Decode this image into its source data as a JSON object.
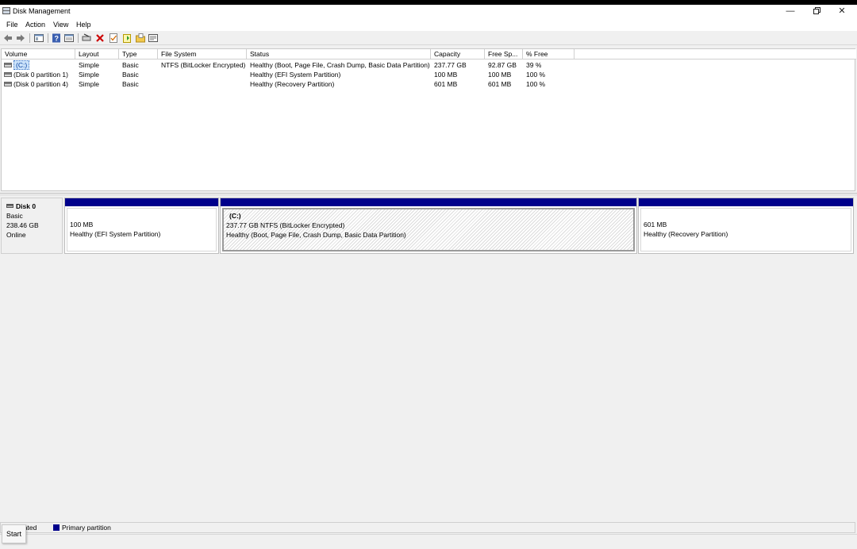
{
  "window": {
    "title": "Disk Management",
    "minimize_glyph": "—",
    "close_glyph": "✕"
  },
  "menu": {
    "file": "File",
    "action": "Action",
    "view": "View",
    "help": "Help"
  },
  "toolbar": {
    "icons": [
      "back-arrow-icon",
      "forward-arrow-icon",
      "console-tree-icon",
      "help-icon",
      "properties-icon",
      "connect-icon",
      "delete-icon",
      "check-icon",
      "new-volume-icon",
      "open-folder-icon",
      "settings-panel-icon"
    ],
    "delete_color": "#cc0000"
  },
  "volume_list": {
    "columns": [
      "Volume",
      "Layout",
      "Type",
      "File System",
      "Status",
      "Capacity",
      "Free Sp...",
      "% Free"
    ],
    "rows": [
      {
        "volume": "(C:)",
        "layout": "Simple",
        "type": "Basic",
        "file_system": "NTFS (BitLocker Encrypted)",
        "status": "Healthy (Boot, Page File, Crash Dump, Basic Data Partition)",
        "capacity": "237.77 GB",
        "free": "92.87 GB",
        "pct_free": "39 %"
      },
      {
        "volume": "(Disk 0 partition 1)",
        "layout": "Simple",
        "type": "Basic",
        "file_system": "",
        "status": "Healthy (EFI System Partition)",
        "capacity": "100 MB",
        "free": "100 MB",
        "pct_free": "100 %"
      },
      {
        "volume": "(Disk 0 partition 4)",
        "layout": "Simple",
        "type": "Basic",
        "file_system": "",
        "status": "Healthy (Recovery Partition)",
        "capacity": "601 MB",
        "free": "601 MB",
        "pct_free": "100 %"
      }
    ]
  },
  "disk": {
    "name": "Disk 0",
    "type": "Basic",
    "size": "238.46 GB",
    "state": "Online",
    "partitions": [
      {
        "size": "100 MB",
        "status": "Healthy (EFI System Partition)"
      },
      {
        "label": "(C:)",
        "size": "237.77 GB NTFS (BitLocker Encrypted)",
        "status": "Healthy (Boot, Page File, Crash Dump, Basic Data Partition)"
      },
      {
        "size": "601 MB",
        "status": "Healthy (Recovery Partition)"
      }
    ]
  },
  "legend": {
    "unallocated": "llocated",
    "primary": "Primary partition",
    "primary_color": "#00008b"
  },
  "start_tooltip": "Start"
}
